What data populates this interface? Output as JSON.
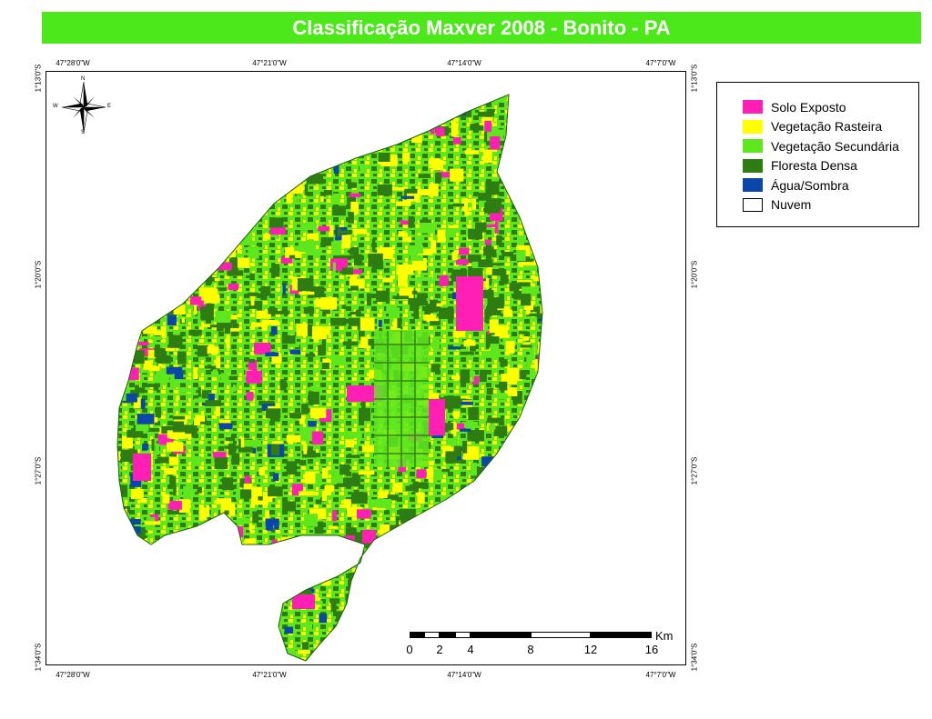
{
  "title": "Classificação Maxver 2008 - Bonito - PA",
  "colors": {
    "title_bg": "#4ce81a",
    "solo_exposto": "#ff1fb4",
    "vegetacao_rasteira": "#ffff00",
    "vegetacao_secundaria": "#5fe71e",
    "floresta_densa": "#2e7d12",
    "agua_sombra": "#0a47a8",
    "nuvem": "#ffffff"
  },
  "legend": {
    "items": [
      {
        "label": "Solo Exposto",
        "color": "#ff1fb4"
      },
      {
        "label": "Vegetação Rasteira",
        "color": "#ffff00"
      },
      {
        "label": "Vegetação Secundária",
        "color": "#5fe71e"
      },
      {
        "label": "Floresta Densa",
        "color": "#2e7d12"
      },
      {
        "label": "Água/Sombra",
        "color": "#0a47a8"
      },
      {
        "label": "Nuvem",
        "color": "#ffffff"
      }
    ]
  },
  "graticule": {
    "top": [
      "47°28'0\"W",
      "47°21'0\"W",
      "47°14'0\"W",
      "47°7'0\"W"
    ],
    "bottom": [
      "47°28'0\"W",
      "47°21'0\"W",
      "47°14'0\"W",
      "47°7'0\"W"
    ],
    "left": [
      "1°13'0\"S",
      "1°20'0\"S",
      "1°27'0\"S",
      "1°34'0\"S"
    ],
    "right": [
      "1°13'0\"S",
      "1°20'0\"S",
      "1°27'0\"S",
      "1°34'0\"S"
    ]
  },
  "compass": {
    "n": "N",
    "s": "S",
    "e": "E",
    "w": "W",
    "icon": "north-arrow-icon"
  },
  "scalebar": {
    "unit": "Km",
    "labels": [
      "0",
      "2",
      "4",
      "8",
      "12",
      "16"
    ]
  }
}
